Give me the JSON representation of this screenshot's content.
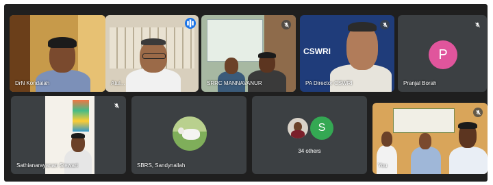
{
  "participants": [
    {
      "name": "DrN Kondaiah",
      "muted": false
    },
    {
      "name": "Atul...",
      "speaking": true
    },
    {
      "name": "SRRC MANNAVANUR",
      "muted": true
    },
    {
      "name": "PA Director CSWRI",
      "muted": true
    },
    {
      "name": "Pranjal Borah",
      "muted": true,
      "avatar_letter": "P",
      "avatar_color": "#e0559c"
    },
    {
      "name": "Sathianarayanan Stewart",
      "muted": true
    },
    {
      "name": "SBRS, Sandynallah",
      "muted": false
    },
    {
      "name": "You",
      "muted": true
    }
  ],
  "others": {
    "label": "34 others",
    "avatar_letter": "S",
    "avatar_color": "#34a853"
  },
  "backdrop_text": {
    "banner_poster": "CSWRI"
  }
}
